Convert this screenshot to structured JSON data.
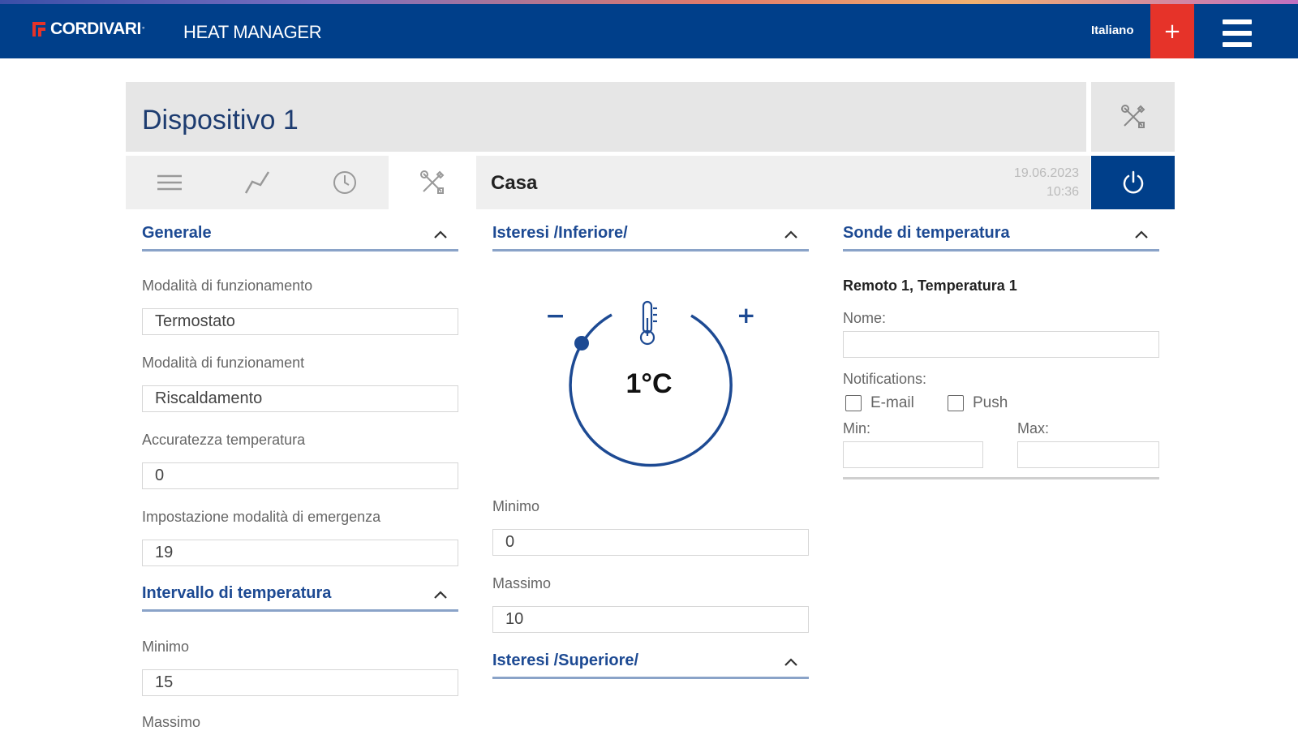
{
  "header": {
    "brand": "CORDIVARI",
    "brand_sup": "°",
    "app_title": "HEAT MANAGER",
    "language": "Italiano",
    "add_label": "+",
    "colors": {
      "primary": "#003f8a",
      "accent": "#e63329"
    }
  },
  "device": {
    "title": "Dispositivo 1",
    "location": "Casa",
    "date": "19.06.2023",
    "time": "10:36"
  },
  "tabs": [
    {
      "icon": "list-icon"
    },
    {
      "icon": "chart-line-icon"
    },
    {
      "icon": "clock-icon"
    },
    {
      "icon": "tools-icon",
      "active": true
    }
  ],
  "generale": {
    "title": "Generale",
    "fields": [
      {
        "label": "Modalità di funzionamento",
        "value": "Termostato"
      },
      {
        "label": "Modalità di funzionament",
        "value": "Riscaldamento"
      },
      {
        "label": "Accuratezza temperatura",
        "value": "0"
      },
      {
        "label": "Impostazione modalità di emergenza",
        "value": "19"
      }
    ]
  },
  "intervallo": {
    "title": "Intervallo di temperatura",
    "min_label": "Minimo",
    "min_value": "15",
    "max_label": "Massimo"
  },
  "isteresi_inferiore": {
    "title": "Isteresi /Inferiore/",
    "dial_value": "1°C",
    "minus": "−",
    "plus": "+",
    "min_label": "Minimo",
    "min_value": "0",
    "max_label": "Massimo",
    "max_value": "10"
  },
  "isteresi_superiore": {
    "title": "Isteresi /Superiore/"
  },
  "sonde": {
    "title": "Sonde di temperatura",
    "probe_title": "Remoto 1, Temperatura 1",
    "name_label": "Nome:",
    "name_value": "",
    "notifications_label": "Notifications:",
    "email_label": "E-mail",
    "push_label": "Push",
    "min_label": "Min:",
    "max_label": "Max:",
    "min_value": "",
    "max_value": ""
  }
}
